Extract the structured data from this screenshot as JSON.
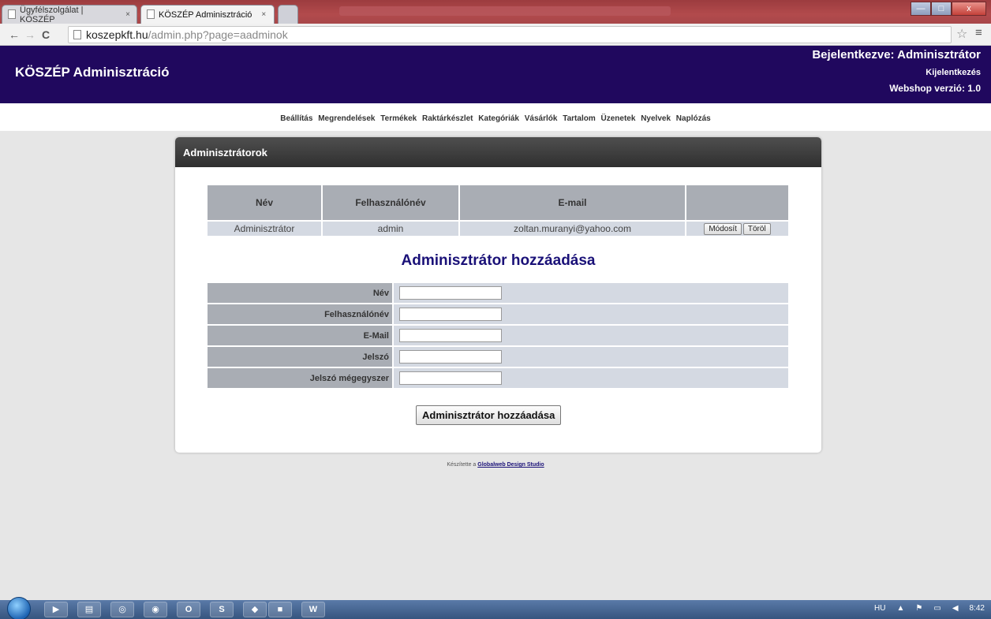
{
  "browser": {
    "tabs": [
      {
        "label": "Ügyfélszolgálat | KÖSZÉP",
        "close": "×"
      },
      {
        "label": "KÖSZÉP Adminisztráció",
        "close": "×"
      }
    ],
    "url_host": "koszepkft.hu",
    "url_path": "/admin.php?page=aadminok",
    "back_icon": "←",
    "forward_icon": "→",
    "reload_icon": "C",
    "star_icon": "☆",
    "menu_icon": "≡",
    "min_icon": "—",
    "max_icon": "□",
    "close_icon": "x"
  },
  "header": {
    "title": "KÖSZÉP Adminisztráció",
    "logged_in": "Bejelentkezve: Adminisztrátor",
    "logout": "Kijelentkezés",
    "version": "Webshop verzió: 1.0"
  },
  "nav": {
    "items": [
      "Beállítás",
      "Megrendelések",
      "Termékek",
      "Raktárkészlet",
      "Kategóriák",
      "Vásárlók",
      "Tartalom",
      "Üzenetek",
      "Nyelvek",
      "Naplózás"
    ]
  },
  "panel": {
    "title": "Adminisztrátorok",
    "table": {
      "headers": [
        "Név",
        "Felhasználónév",
        "E-mail",
        ""
      ],
      "rows": [
        {
          "name": "Adminisztrátor",
          "username": "admin",
          "email": "zoltan.muranyi@yahoo.com",
          "edit": "Módosít",
          "delete": "Töröl"
        }
      ]
    },
    "form": {
      "title": "Adminisztrátor hozzáadása",
      "fields": [
        {
          "label": "Név",
          "value": ""
        },
        {
          "label": "Felhasználónév",
          "value": ""
        },
        {
          "label": "E-Mail",
          "value": ""
        },
        {
          "label": "Jelszó",
          "value": ""
        },
        {
          "label": "Jelszó mégegyszer",
          "value": ""
        }
      ],
      "submit": "Adminisztrátor hozzáadása"
    }
  },
  "footer": {
    "text": "Készítette a",
    "link": "Globalweb Design Studio"
  },
  "taskbar": {
    "icons": [
      "media-player-icon",
      "explorer-icon",
      "chrome-icon",
      "firefox-icon",
      "opera-icon",
      "skype-icon",
      "paint-icon",
      "save-icon",
      "word-icon"
    ],
    "icon_glyphs": [
      "▶",
      "▤",
      "◎",
      "◉",
      "O",
      "S",
      "◆",
      "■",
      "W"
    ],
    "lang": "HU",
    "clock": "8:42"
  },
  "colors": {
    "header_bg": "#20085e",
    "accent": "#1a1178",
    "tab_strip": "#9c3c3f"
  }
}
